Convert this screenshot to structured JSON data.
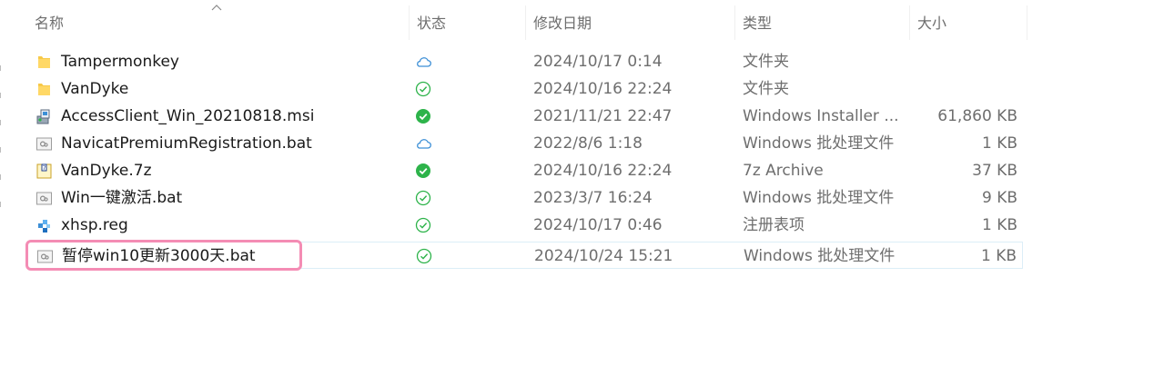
{
  "header": {
    "name": "名称",
    "status": "状态",
    "modified": "修改日期",
    "type": "类型",
    "size": "大小"
  },
  "colors": {
    "accent": "#f48cb4",
    "ok_green": "#2db34a",
    "cloud_blue": "#3c8fd6",
    "folder": "#f7c948",
    "text_muted": "#6e6e6e"
  },
  "files": [
    {
      "name": "Tampermonkey",
      "status": "cloud-icon",
      "date": "2024/10/17 0:14",
      "type": "文件夹",
      "size": "",
      "icon": "folder-icon"
    },
    {
      "name": "VanDyke",
      "status": "check-outline-icon",
      "date": "2024/10/16 22:24",
      "type": "文件夹",
      "size": "",
      "icon": "folder-icon"
    },
    {
      "name": "AccessClient_Win_20210818.msi",
      "status": "check-filled-icon",
      "date": "2021/11/21 22:47",
      "type": "Windows Installer ...",
      "size": "61,860 KB",
      "icon": "installer-icon"
    },
    {
      "name": "NavicatPremiumRegistration.bat",
      "status": "cloud-icon",
      "date": "2022/8/6 1:18",
      "type": "Windows 批处理文件",
      "size": "1 KB",
      "icon": "batch-file-icon"
    },
    {
      "name": "VanDyke.7z",
      "status": "check-filled-icon",
      "date": "2024/10/16 22:24",
      "type": "7z Archive",
      "size": "37 KB",
      "icon": "archive-icon"
    },
    {
      "name": "Win一键激活.bat",
      "status": "check-outline-icon",
      "date": "2023/3/7 16:24",
      "type": "Windows 批处理文件",
      "size": "9 KB",
      "icon": "batch-file-icon"
    },
    {
      "name": "xhsp.reg",
      "status": "check-outline-icon",
      "date": "2024/10/17 0:46",
      "type": "注册表项",
      "size": "1 KB",
      "icon": "registry-icon"
    },
    {
      "name": "暂停win10更新3000天.bat",
      "status": "check-outline-icon",
      "date": "2024/10/24 15:21",
      "type": "Windows 批处理文件",
      "size": "1 KB",
      "icon": "batch-file-icon"
    }
  ]
}
